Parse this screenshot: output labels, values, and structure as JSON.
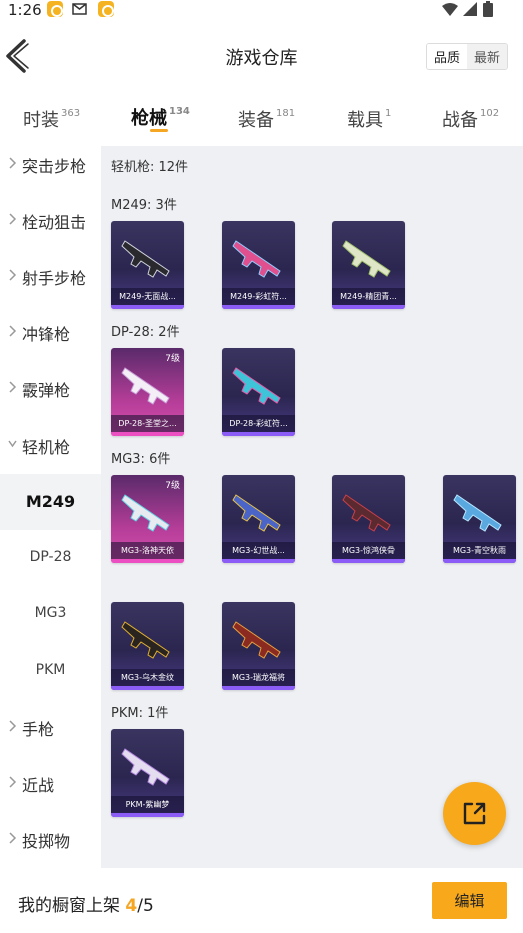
{
  "status_bar": {
    "time": "1:26"
  },
  "header": {
    "title": "游戏仓库",
    "sort_options": [
      "品质",
      "最新"
    ]
  },
  "tabs": [
    {
      "label": "时装",
      "count": "363"
    },
    {
      "label": "枪械",
      "count": "134"
    },
    {
      "label": "装备",
      "count": "181"
    },
    {
      "label": "载具",
      "count": "1"
    },
    {
      "label": "战备",
      "count": "102"
    }
  ],
  "sidebar": {
    "categories": [
      "突击步枪",
      "栓动狙击",
      "射手步枪",
      "冲锋枪",
      "霰弹枪",
      "轻机枪"
    ],
    "sub_items": [
      "M249",
      "DP-28",
      "MG3",
      "PKM"
    ],
    "tail_categories": [
      "手枪",
      "近战",
      "投掷物"
    ]
  },
  "content": {
    "section_title": "轻机枪: 12件",
    "groups": [
      {
        "title": "M249: 3件",
        "items": [
          {
            "name": "M249-无面战...",
            "level": ""
          },
          {
            "name": "M249-彩虹符...",
            "level": ""
          },
          {
            "name": "M249-精团青...",
            "level": ""
          }
        ]
      },
      {
        "title": "DP-28: 2件",
        "items": [
          {
            "name": "DP-28-圣堂之...",
            "level": "7级"
          },
          {
            "name": "DP-28-彩虹符...",
            "level": ""
          }
        ]
      },
      {
        "title": "MG3: 6件",
        "items": [
          {
            "name": "MG3-洛神天依",
            "level": "7级"
          },
          {
            "name": "MG3-幻世战...",
            "level": ""
          },
          {
            "name": "MG3-惊鸿侠骨",
            "level": ""
          },
          {
            "name": "MG3-青空秋雨",
            "level": ""
          },
          {
            "name": "MG3-乌木金纹",
            "level": ""
          },
          {
            "name": "MG3-瑞龙福将",
            "level": ""
          }
        ]
      },
      {
        "title": "PKM: 1件",
        "items": [
          {
            "name": "PKM-紫幽梦",
            "level": ""
          }
        ]
      }
    ]
  },
  "bottom_bar": {
    "showcase_label": "我的橱窗上架",
    "showcase_count": "4",
    "showcase_total": "/5",
    "edit_label": "编辑"
  },
  "colors": {
    "accent": "#f7a81b",
    "rare_card": "#d94fb0",
    "epic_card": "#2b2650"
  }
}
